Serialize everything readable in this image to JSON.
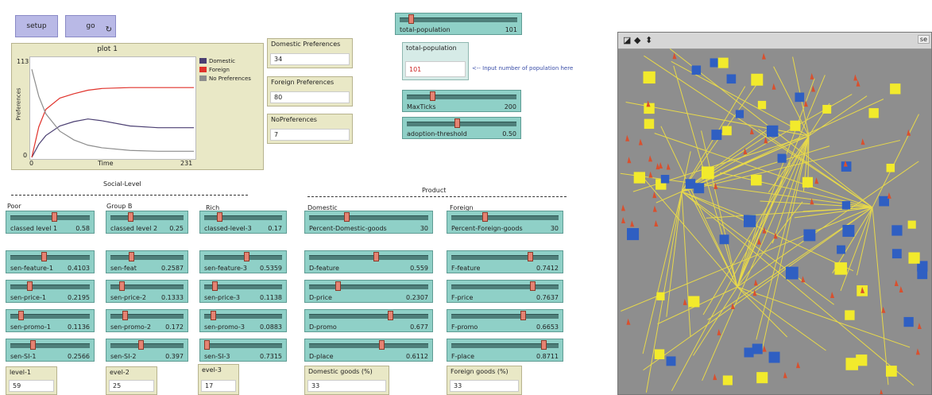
{
  "buttons": {
    "setup": "setup",
    "go": "go"
  },
  "plot": {
    "title": "plot 1",
    "ylabel": "Preferences",
    "xlabel": "Time",
    "ymax_label": "113",
    "ymin_label": "0",
    "xmin_label": "0",
    "xmax_label": "231",
    "legend": [
      {
        "name": "Domestic",
        "color": "#4b3f72"
      },
      {
        "name": "Foreign",
        "color": "#e0322b"
      },
      {
        "name": "No Preferences",
        "color": "#8d8d8d"
      }
    ]
  },
  "chart_data": {
    "type": "line",
    "title": "plot 1",
    "xlabel": "Time",
    "ylabel": "Preferences",
    "xlim": [
      0,
      231
    ],
    "ylim": [
      0,
      113
    ],
    "x": [
      0,
      10,
      20,
      40,
      60,
      80,
      100,
      140,
      180,
      231
    ],
    "series": [
      {
        "name": "Domestic",
        "color": "#4b3f72",
        "values": [
          0,
          15,
          25,
          36,
          41,
          44,
          42,
          36,
          34,
          34
        ]
      },
      {
        "name": "Foreign",
        "color": "#e0322b",
        "values": [
          0,
          35,
          55,
          68,
          73,
          77,
          79,
          80,
          80,
          80
        ]
      },
      {
        "name": "No Preferences",
        "color": "#8d8d8d",
        "values": [
          101,
          70,
          50,
          30,
          20,
          14,
          11,
          8,
          7,
          7
        ]
      }
    ]
  },
  "monitors": {
    "domestic_pref": {
      "label": "Domestic Preferences",
      "value": "34"
    },
    "foreign_pref": {
      "label": "Foreign Preferences",
      "value": "80"
    },
    "no_pref": {
      "label": "NoPreferences",
      "value": "7"
    },
    "total_pop_input": {
      "label": "total-population",
      "value": "101"
    },
    "level1": {
      "label": "level-1",
      "value": "59"
    },
    "level2": {
      "label": "evel-2",
      "value": "25"
    },
    "level3": {
      "label": "evel-3",
      "value": "17"
    },
    "domestic_goods": {
      "label": "Domestic goods (%)",
      "value": "33"
    },
    "foreign_goods": {
      "label": "Foreign goods (%)",
      "value": "33"
    }
  },
  "annotation": "<-- Input number of population here",
  "top_sliders": [
    {
      "label": "total-population",
      "value": "101",
      "pos": 0.08
    },
    {
      "label": "MaxTicks",
      "value": "200",
      "pos": 0.22
    },
    {
      "label": "adoption-threshold",
      "value": "0.50",
      "pos": 0.45
    }
  ],
  "section_headers": {
    "social": "Social-Level",
    "product": "Product",
    "poor": "Poor",
    "group_b": "Group B",
    "rich": "Rich",
    "domestic": "Domestic",
    "foreign": "Foreign"
  },
  "columns": {
    "poor": [
      {
        "label": "classed level 1",
        "value": "0.58",
        "pos": 0.55
      },
      {
        "label": "sen-feature-1",
        "value": "0.4103",
        "pos": 0.41
      },
      {
        "label": "sen-price-1",
        "value": "0.2195",
        "pos": 0.22
      },
      {
        "label": "sen-promo-1",
        "value": "0.1136",
        "pos": 0.11
      },
      {
        "label": "sen-SI-1",
        "value": "0.2566",
        "pos": 0.26
      }
    ],
    "group_b": [
      {
        "label": "classed level 2",
        "value": "0.25",
        "pos": 0.25
      },
      {
        "label": "sen-feat",
        "value": "0.2587",
        "pos": 0.26
      },
      {
        "label": "sen-price-2",
        "value": "0.1333",
        "pos": 0.13
      },
      {
        "label": "sen-promo-2",
        "value": "0.172",
        "pos": 0.17
      },
      {
        "label": "sen-SI-2",
        "value": "0.397",
        "pos": 0.4
      }
    ],
    "rich": [
      {
        "label": "classed-level-3",
        "value": "0.17",
        "pos": 0.17
      },
      {
        "label": "sen-feature-3",
        "value": "0.5359",
        "pos": 0.54
      },
      {
        "label": "sen-price-3",
        "value": "0.1138",
        "pos": 0.11
      },
      {
        "label": "sen-promo-3",
        "value": "0.0883",
        "pos": 0.09
      },
      {
        "label": "sen-SI-3",
        "value": "0.7315",
        "pos": 0.0
      }
    ],
    "domestic": [
      {
        "label": "Percent-Domestic-goods",
        "value": "30",
        "pos": 0.3
      },
      {
        "label": "D-feature",
        "value": "0.559",
        "pos": 0.56
      },
      {
        "label": "D-price",
        "value": "0.2307",
        "pos": 0.23
      },
      {
        "label": "D-promo",
        "value": "0.677",
        "pos": 0.68
      },
      {
        "label": "D-place",
        "value": "0.6112",
        "pos": 0.61
      }
    ],
    "foreign": [
      {
        "label": "Percent-Foreign-goods",
        "value": "30",
        "pos": 0.3
      },
      {
        "label": "F-feature",
        "value": "0.7412",
        "pos": 0.74
      },
      {
        "label": "F-price",
        "value": "0.7637",
        "pos": 0.76
      },
      {
        "label": "F-promo",
        "value": "0.6653",
        "pos": 0.67
      },
      {
        "label": "F-place",
        "value": "0.8711",
        "pos": 0.87
      }
    ]
  },
  "world": {
    "toolbar_right": "se"
  }
}
